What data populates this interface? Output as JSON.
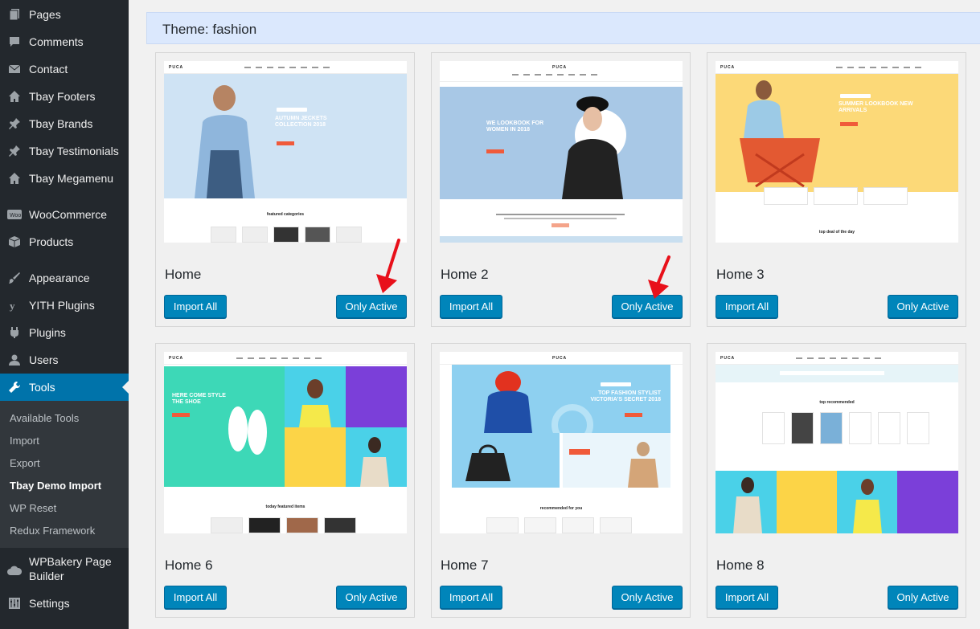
{
  "sidebar": {
    "items": [
      {
        "label": "Pages",
        "icon": "pages-icon"
      },
      {
        "label": "Comments",
        "icon": "comments-icon"
      },
      {
        "label": "Contact",
        "icon": "mail-icon"
      },
      {
        "label": "Tbay Footers",
        "icon": "home-icon"
      },
      {
        "label": "Tbay Brands",
        "icon": "pin-icon"
      },
      {
        "label": "Tbay Testimonials",
        "icon": "pin-icon"
      },
      {
        "label": "Tbay Megamenu",
        "icon": "home-icon"
      },
      {
        "label": "WooCommerce",
        "icon": "woo-icon"
      },
      {
        "label": "Products",
        "icon": "products-box-icon"
      },
      {
        "label": "Appearance",
        "icon": "paintbrush-icon"
      },
      {
        "label": "YITH Plugins",
        "icon": "yith-icon"
      },
      {
        "label": "Plugins",
        "icon": "plugins-icon"
      },
      {
        "label": "Users",
        "icon": "users-icon"
      },
      {
        "label": "Tools",
        "icon": "wrench-icon"
      },
      {
        "label": "WPBakery Page Builder",
        "icon": "cloud-icon"
      },
      {
        "label": "Settings",
        "icon": "settings-sliders-icon"
      }
    ],
    "submenu": [
      "Available Tools",
      "Import",
      "Export",
      "Tbay Demo Import",
      "WP Reset",
      "Redux Framework"
    ],
    "active_item": "Tools",
    "current_submenu": "Tbay Demo Import"
  },
  "panel": {
    "theme_title": "Theme: fashion",
    "import_all_label": "Import All",
    "only_active_label": "Only Active",
    "demos": [
      {
        "name": "Home",
        "brand": "PUCA",
        "hero": "AUTUMN JECKETS COLLECTION 2018",
        "section": "featured categories"
      },
      {
        "name": "Home 2",
        "brand": "PUCA",
        "hero": "WE LOOKBOOK FOR WOMEN IN 2018",
        "section": ""
      },
      {
        "name": "Home 3",
        "brand": "PUCA",
        "hero": "SUMMER LOOKBOOK NEW ARRIVALS",
        "section": "top deal of the day"
      },
      {
        "name": "Home 6",
        "brand": "PUCA",
        "hero": "HERE COME STYLE THE SHOE",
        "section": "today featured items"
      },
      {
        "name": "Home 7",
        "brand": "PUCA",
        "hero": "TOP FASHION STYLIST VICTORIA'S SECRET 2018",
        "section": "recommended for you"
      },
      {
        "name": "Home 8",
        "brand": "PUCA",
        "hero": "top recommended",
        "section": ""
      }
    ]
  },
  "colors": {
    "sidebar_bg": "#23282d",
    "active_bg": "#0073aa",
    "button_bg": "#0085ba",
    "header_bg": "#dbe8fd",
    "arrow_red": "#e8101a"
  }
}
